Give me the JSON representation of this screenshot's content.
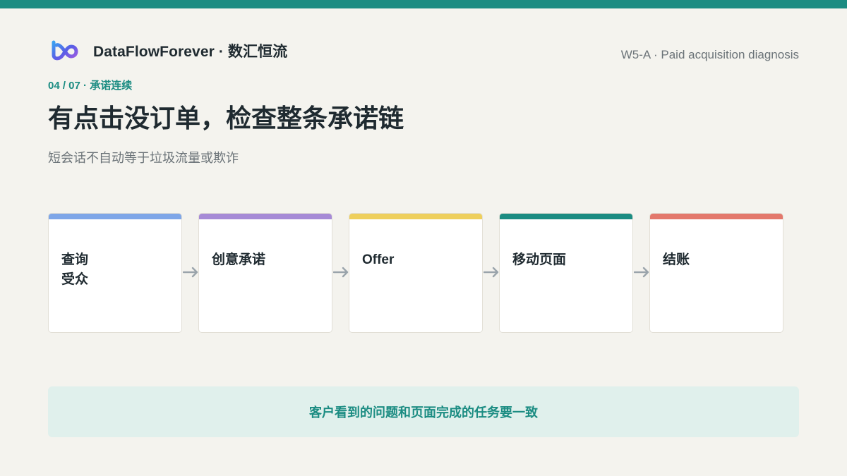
{
  "brand": {
    "name": "DataFlowForever · 数汇恒流",
    "logo_icon": "infinity-logo-icon"
  },
  "deck_label": "W5-A · Paid acquisition diagnosis",
  "section_tag": "04 / 07 · 承诺连续",
  "title": "有点击没订单，检查整条承诺链",
  "subtitle": "短会话不自动等于垃圾流量或欺诈",
  "chain": [
    {
      "label": "查询\n受众",
      "color": "#7ea6e8"
    },
    {
      "label": "创意承诺",
      "color": "#a68ad6"
    },
    {
      "label": "Offer",
      "color": "#eecf5c"
    },
    {
      "label": "移动页面",
      "color": "#1b8c82"
    },
    {
      "label": "结账",
      "color": "#e3786c"
    }
  ],
  "callout": "客户看到的问题和页面完成的任务要一致",
  "colors": {
    "accent": "#1b8c82",
    "background": "#f4f3ee",
    "arrow": "#9aa4ab"
  }
}
